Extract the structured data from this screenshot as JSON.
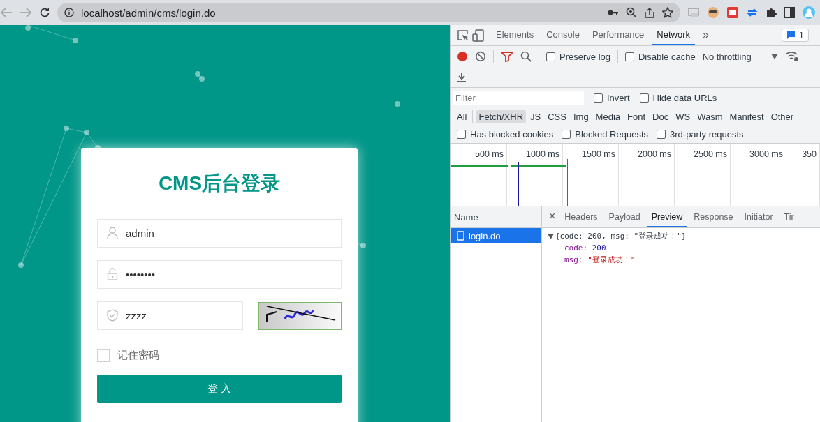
{
  "browser": {
    "url": "localhost/admin/cms/login.do"
  },
  "login": {
    "title": "CMS后台登录",
    "fields": [
      {
        "kind": "user",
        "value": "admin"
      },
      {
        "kind": "password",
        "value": "••••••••"
      },
      {
        "kind": "captcha",
        "value": "zzzz"
      }
    ],
    "remember": {
      "label": "记住密码",
      "checked": false
    },
    "submit": "登 入"
  },
  "devtools": {
    "tabs": [
      {
        "label": "Elements",
        "selected": false
      },
      {
        "label": "Console",
        "selected": false
      },
      {
        "label": "Performance",
        "selected": false
      },
      {
        "label": "Network",
        "selected": true
      }
    ],
    "more": "»",
    "issues": "1",
    "preserve_log": {
      "label": "Preserve log",
      "checked": false
    },
    "disable_cache": {
      "label": "Disable cache",
      "checked": false
    },
    "throttling": "No throttling",
    "filter": {
      "placeholder": "Filter"
    },
    "invert": {
      "label": "Invert",
      "checked": false
    },
    "hide_data_urls": {
      "label": "Hide data URLs",
      "checked": false
    },
    "types": [
      {
        "label": "All",
        "selected": false
      },
      {
        "label": "Fetch/XHR",
        "selected": true
      },
      {
        "label": "JS",
        "selected": false
      },
      {
        "label": "CSS",
        "selected": false
      },
      {
        "label": "Img",
        "selected": false
      },
      {
        "label": "Media",
        "selected": false
      },
      {
        "label": "Font",
        "selected": false
      },
      {
        "label": "Doc",
        "selected": false
      },
      {
        "label": "WS",
        "selected": false
      },
      {
        "label": "Wasm",
        "selected": false
      },
      {
        "label": "Manifest",
        "selected": false
      },
      {
        "label": "Other",
        "selected": false
      }
    ],
    "blocked": [
      {
        "label": "Has blocked cookies",
        "checked": false
      },
      {
        "label": "Blocked Requests",
        "checked": false
      },
      {
        "label": "3rd-party requests",
        "checked": false
      }
    ],
    "timeline_ticks": [
      "500 ms",
      "1000 ms",
      "1500 ms",
      "2000 ms",
      "2500 ms",
      "3000 ms",
      "350"
    ],
    "name_header": "Name",
    "requests": [
      {
        "name": "login.do",
        "selected": true
      }
    ],
    "close": "×",
    "detail_tabs": [
      {
        "label": "Headers",
        "selected": false
      },
      {
        "label": "Payload",
        "selected": false
      },
      {
        "label": "Preview",
        "selected": true
      },
      {
        "label": "Response",
        "selected": false
      },
      {
        "label": "Initiator",
        "selected": false
      },
      {
        "label": "Tir",
        "selected": false
      }
    ],
    "preview": {
      "summary": "{code: 200, msg: \"登录成功！\"}",
      "props": [
        {
          "key": "code:",
          "value": "200",
          "kind": "number"
        },
        {
          "key": "msg:",
          "value": "\"登录成功！\"",
          "kind": "string"
        }
      ]
    }
  }
}
